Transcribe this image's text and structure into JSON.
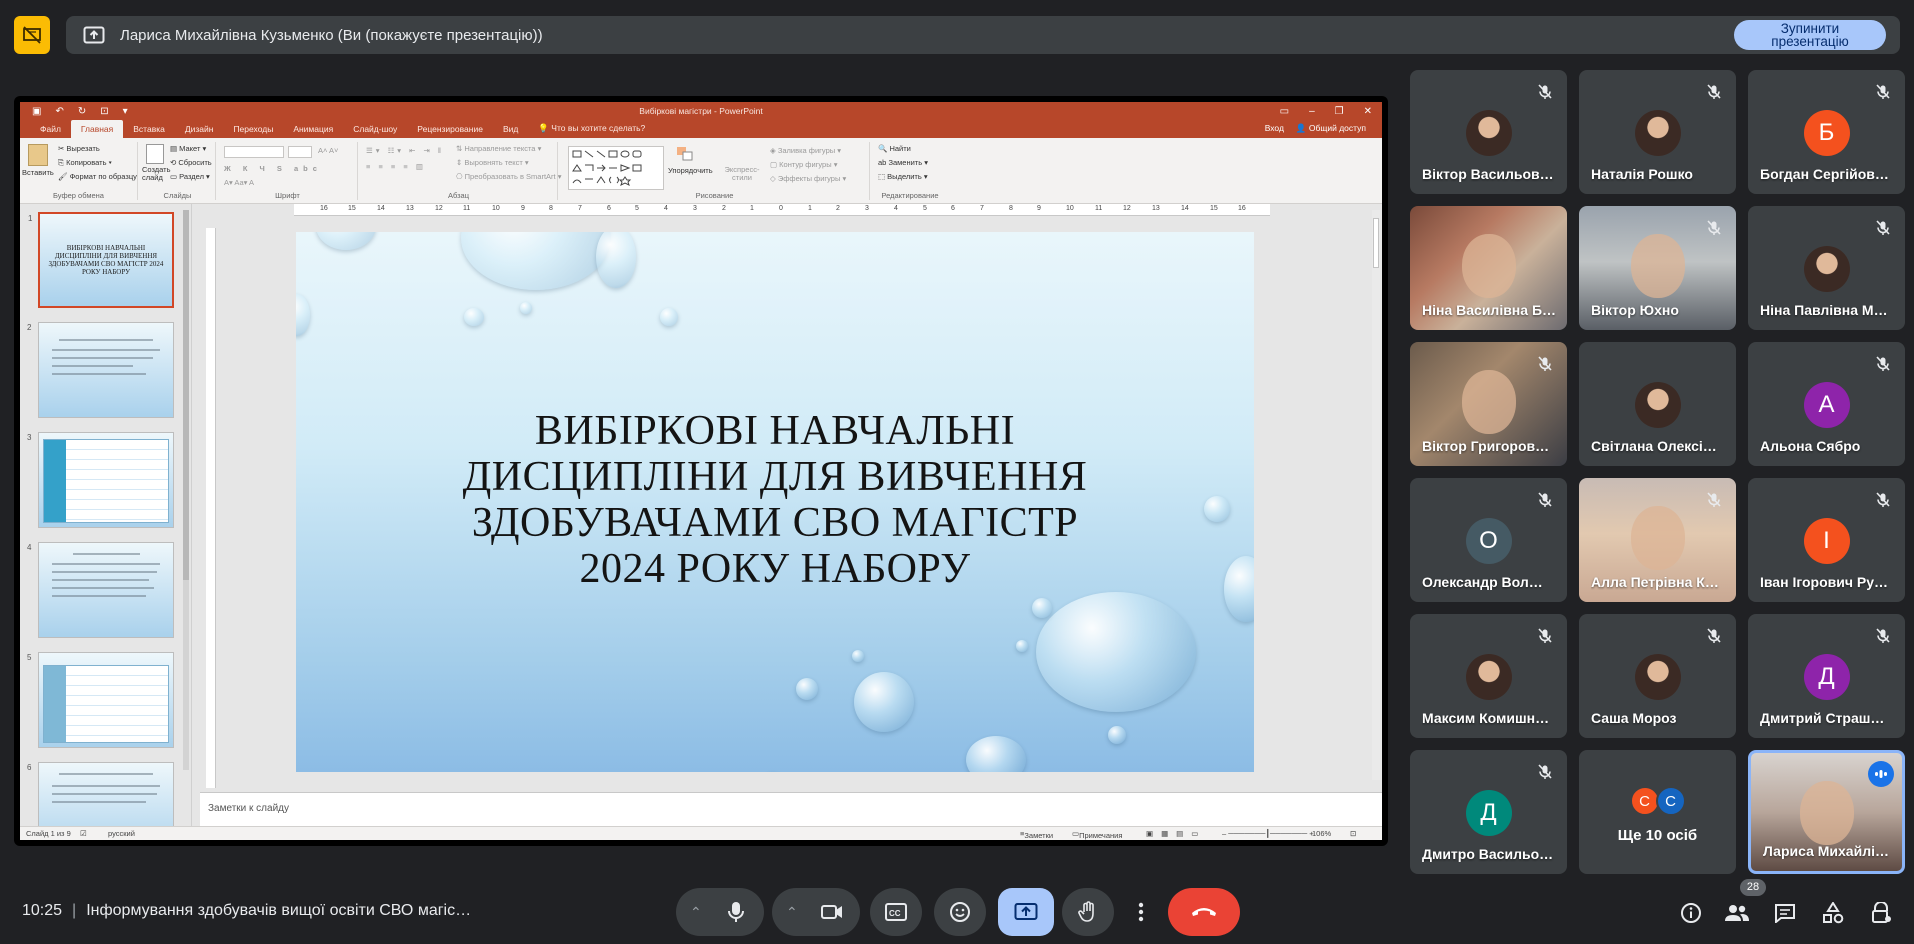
{
  "presenting_bar": {
    "text": "Лариса Михайлівна Кузьменко (Ви (покажуєте презентацію))",
    "stop_button": "Зупинити презентацію"
  },
  "powerpoint": {
    "window_title": "Вибіркові магістри - PowerPoint",
    "tabs": [
      "Файл",
      "Главная",
      "Вставка",
      "Дизайн",
      "Переходы",
      "Анимация",
      "Слайд-шоу",
      "Рецензирование",
      "Вид"
    ],
    "tell_me": "Что вы хотите сделать?",
    "sign_in": "Вход",
    "share": "Общий доступ",
    "ribbon": {
      "paste": "Вставить",
      "cut": "Вырезать",
      "copy": "Копировать",
      "format_painter": "Формат по образцу",
      "clipboard_group": "Буфер обмена",
      "new_slide": "Создать слайд",
      "layout": "Макет",
      "reset": "Сбросить",
      "section": "Раздел",
      "slides_group": "Слайды",
      "font_group": "Шрифт",
      "paragraph_group": "Абзац",
      "text_direction": "Направление текста",
      "align_text": "Выровнять текст",
      "smartart": "Преобразовать в SmartArt",
      "arrange": "Упорядочить",
      "quick_styles": "Экспресс-стили",
      "shape_fill": "Заливка фигуры",
      "shape_outline": "Контур фигуры",
      "shape_effects": "Эффекты фигуры",
      "drawing_group": "Рисование",
      "find": "Найти",
      "replace": "Заменить",
      "select": "Выделить",
      "editing_group": "Редактирование"
    },
    "thumbnail_numbers": [
      "1",
      "2",
      "3",
      "4",
      "5",
      "6"
    ],
    "thumb1_text": "ВИБІРКОВІ НАВЧАЛЬНІ ДИСЦИПЛІНИ ДЛЯ ВИВЧЕННЯ ЗДОБУВАЧАМИ СВО МАГІСТР 2024 РОКУ НАБОРУ",
    "ruler_numbers": [
      "16",
      "15",
      "14",
      "13",
      "12",
      "11",
      "10",
      "9",
      "8",
      "7",
      "6",
      "5",
      "4",
      "3",
      "2",
      "1",
      "0",
      "1",
      "2",
      "3",
      "4",
      "5",
      "6",
      "7",
      "8",
      "9",
      "10",
      "11",
      "12",
      "13",
      "14",
      "15",
      "16"
    ],
    "slide_title_lines": [
      "ВИБІРКОВІ НАВЧАЛЬНІ",
      "ДИСЦИПЛІНИ ДЛЯ ВИВЧЕННЯ",
      "ЗДОБУВАЧАМИ СВО МАГІСТР",
      "2024 РОКУ НАБОРУ"
    ],
    "notes_placeholder": "Заметки к слайду",
    "status": {
      "slide_of": "Слайд 1 из 9",
      "language": "русский",
      "notes": "Заметки",
      "comments": "Примечания",
      "zoom": "106%"
    }
  },
  "participants": [
    {
      "name": "Віктор Васильов…",
      "type": "photo",
      "muted": true
    },
    {
      "name": "Наталія Рошко",
      "type": "photo",
      "muted": true
    },
    {
      "name": "Богдан Сергійов…",
      "type": "letter",
      "letter": "Б",
      "color": "#f4511e",
      "muted": true
    },
    {
      "name": "Ніна Василівна Б…",
      "type": "video",
      "muted": false
    },
    {
      "name": "Віктор Юхно",
      "type": "video",
      "muted": true
    },
    {
      "name": "Ніна Павлівна М…",
      "type": "photo",
      "muted": true
    },
    {
      "name": "Віктор Григоров…",
      "type": "video",
      "muted": true
    },
    {
      "name": "Світлана Олексі…",
      "type": "photo",
      "muted": false
    },
    {
      "name": "Альона Сябро",
      "type": "letter",
      "letter": "А",
      "color": "#8e24aa",
      "muted": true
    },
    {
      "name": "Олександр Вол…",
      "type": "letter",
      "letter": "О",
      "color": "#455a64",
      "muted": true
    },
    {
      "name": "Алла Петрівна К…",
      "type": "video",
      "muted": true
    },
    {
      "name": "Іван Ігорович Ру…",
      "type": "letter",
      "letter": "І",
      "color": "#f4511e",
      "muted": true
    },
    {
      "name": "Максим Комишн…",
      "type": "photo",
      "muted": true
    },
    {
      "name": "Саша Мороз",
      "type": "photo",
      "muted": true
    },
    {
      "name": "Дмитрий Страш…",
      "type": "letter",
      "letter": "Д",
      "color": "#8e24aa",
      "muted": true
    },
    {
      "name": "Дмитро Васильо…",
      "type": "letter",
      "letter": "Д",
      "color": "#00897b",
      "muted": true
    },
    {
      "name": "Ще 10 осіб",
      "type": "more",
      "letters": [
        "С",
        "С"
      ],
      "colors": [
        "#f4511e",
        "#1565c0"
      ]
    },
    {
      "name": "Лариса Михайлі…",
      "type": "video",
      "speaking": true
    }
  ],
  "bottom": {
    "time": "10:25",
    "meeting_title": "Інформування здобувачів вищої освіти СВО магіс…",
    "people_count": "28"
  },
  "colors": {
    "ppt_accent": "#b7472a",
    "meet_background": "#202124",
    "tile_background": "#3c4043",
    "present_active": "#a8c7fa",
    "end_call": "#ea4335"
  }
}
